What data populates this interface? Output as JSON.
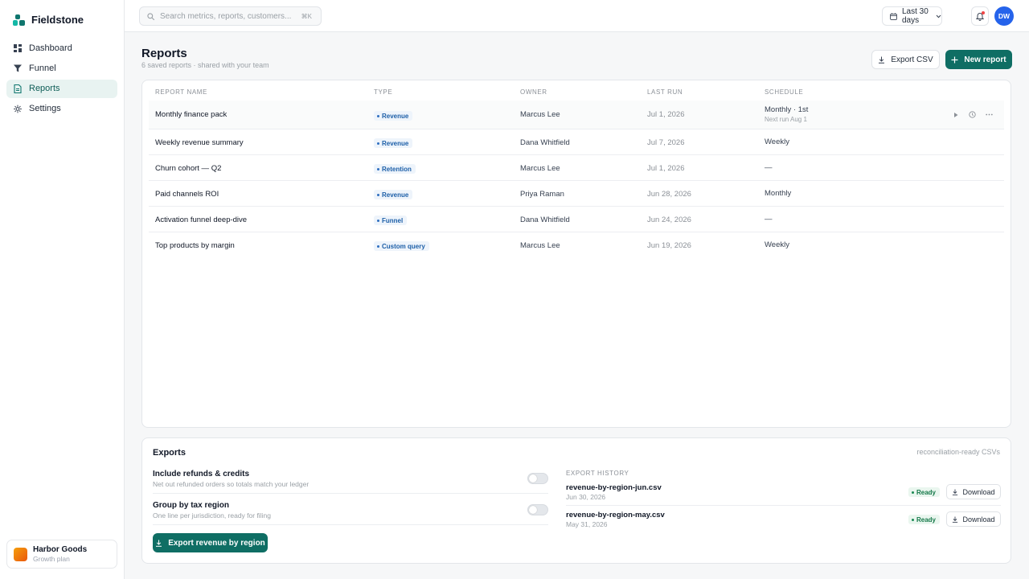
{
  "brand": {
    "name": "Fieldstone"
  },
  "sidebar": {
    "items": [
      {
        "label": "Dashboard",
        "icon": "dashboard-icon"
      },
      {
        "label": "Funnel",
        "icon": "funnel-icon"
      },
      {
        "label": "Reports",
        "icon": "document-icon",
        "active": true
      },
      {
        "label": "Settings",
        "icon": "gear-icon"
      }
    ],
    "org": {
      "name": "Harbor Goods",
      "plan": "Growth plan"
    }
  },
  "topbar": {
    "search_placeholder": "Search metrics, reports, customers...",
    "search_shortcut": "⌘K",
    "date_range": "Last 30 days",
    "avatar_initials": "DW"
  },
  "page": {
    "title": "Reports",
    "subtitle": "6 saved reports · shared with your team",
    "export_csv_label": "Export CSV",
    "new_report_label": "New report"
  },
  "table": {
    "columns": [
      "Report name",
      "Type",
      "Owner",
      "Last run",
      "Schedule"
    ],
    "rows": [
      {
        "name": "Monthly finance pack",
        "type": "Revenue",
        "owner": "Marcus Lee",
        "last_run": "Jul 1, 2026",
        "schedule": "Monthly · 1st",
        "schedule_sub": "Next run Aug 1"
      },
      {
        "name": "Weekly revenue summary",
        "type": "Revenue",
        "owner": "Dana Whitfield",
        "last_run": "Jul 7, 2026",
        "schedule": "Weekly"
      },
      {
        "name": "Churn cohort — Q2",
        "type": "Retention",
        "owner": "Marcus Lee",
        "last_run": "Jul 1, 2026",
        "schedule": "—"
      },
      {
        "name": "Paid channels ROI",
        "type": "Revenue",
        "owner": "Priya Raman",
        "last_run": "Jun 28, 2026",
        "schedule": "Monthly"
      },
      {
        "name": "Activation funnel deep-dive",
        "type": "Funnel",
        "owner": "Dana Whitfield",
        "last_run": "Jun 24, 2026",
        "schedule": "—"
      },
      {
        "name": "Top products by margin",
        "type": "Custom query",
        "owner": "Marcus Lee",
        "last_run": "Jun 19, 2026",
        "schedule": "Weekly"
      }
    ]
  },
  "exports": {
    "title": "Exports",
    "note": "reconciliation-ready CSVs",
    "options": [
      {
        "title": "Include refunds & credits",
        "desc": "Net out refunded orders so totals match your ledger",
        "enabled": false
      },
      {
        "title": "Group by tax region",
        "desc": "One line per jurisdiction, ready for filing",
        "enabled": false
      }
    ],
    "export_button": "Export revenue by region",
    "history_label": "Export history",
    "history": [
      {
        "file": "revenue-by-region-jun.csv",
        "date": "Jun 30, 2026",
        "status": "Ready",
        "action": "Download"
      },
      {
        "file": "revenue-by-region-may.csv",
        "date": "May 31, 2026",
        "status": "Ready",
        "action": "Download"
      }
    ]
  },
  "colors": {
    "accent": "#0f6e64",
    "active_bg": "#e8f3f1",
    "badge_blue": "#1d5fa8",
    "ready_green": "#16794a",
    "avatar": "#2563eb"
  }
}
